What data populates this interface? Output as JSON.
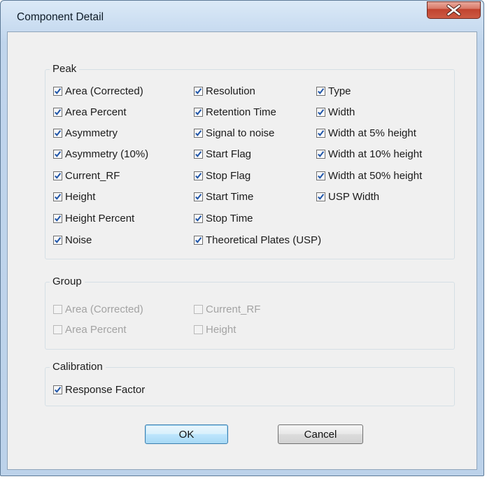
{
  "window": {
    "title": "Component Detail"
  },
  "colors": {
    "check": "#1f55a8",
    "accent": "#3c7fb1"
  },
  "peak": {
    "legend": "Peak",
    "items": [
      {
        "label": "Area (Corrected)",
        "checked": true
      },
      {
        "label": "Area Percent",
        "checked": true
      },
      {
        "label": "Asymmetry",
        "checked": true
      },
      {
        "label": "Asymmetry (10%)",
        "checked": true
      },
      {
        "label": "Current_RF",
        "checked": true
      },
      {
        "label": "Height",
        "checked": true
      },
      {
        "label": "Height Percent",
        "checked": true
      },
      {
        "label": "Noise",
        "checked": true
      },
      {
        "label": "Resolution",
        "checked": true
      },
      {
        "label": "Retention Time",
        "checked": true
      },
      {
        "label": "Signal to noise",
        "checked": true
      },
      {
        "label": "Start Flag",
        "checked": true
      },
      {
        "label": "Stop Flag",
        "checked": true
      },
      {
        "label": "Start Time",
        "checked": true
      },
      {
        "label": "Stop Time",
        "checked": true
      },
      {
        "label": "Theoretical Plates (USP)",
        "checked": true
      },
      {
        "label": "Type",
        "checked": true
      },
      {
        "label": "Width",
        "checked": true
      },
      {
        "label": "Width at 5% height",
        "checked": true
      },
      {
        "label": "Width at 10% height",
        "checked": true
      },
      {
        "label": "Width at 50% height",
        "checked": true
      },
      {
        "label": "USP Width",
        "checked": true
      }
    ]
  },
  "group": {
    "legend": "Group",
    "items": [
      {
        "label": "Area (Corrected)",
        "checked": false,
        "disabled": true
      },
      {
        "label": "Area Percent",
        "checked": false,
        "disabled": true
      },
      {
        "label": "Current_RF",
        "checked": false,
        "disabled": true
      },
      {
        "label": "Height",
        "checked": false,
        "disabled": true
      }
    ]
  },
  "calibration": {
    "legend": "Calibration",
    "items": [
      {
        "label": "Response Factor",
        "checked": true
      }
    ]
  },
  "buttons": {
    "ok": "OK",
    "cancel": "Cancel"
  }
}
